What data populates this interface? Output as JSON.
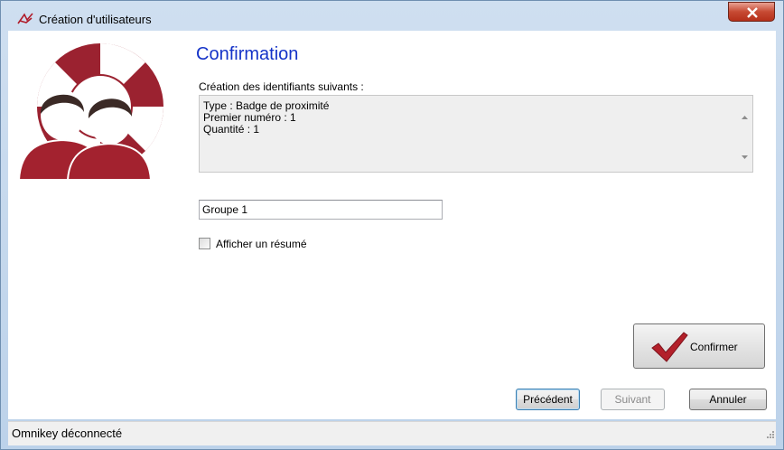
{
  "window": {
    "title": "Création d'utilisateurs",
    "app_icon": "users-wizard-icon",
    "close_icon": "close-icon"
  },
  "main": {
    "heading": "Confirmation",
    "summary_label": "Création des identifiants suivants :",
    "summary_lines": [
      "Type : Badge de proximité",
      "Premier numéro : 1",
      "Quantité : 1"
    ],
    "group_value": "Groupe 1",
    "show_summary_label": "Afficher un résumé",
    "show_summary_checked": false
  },
  "buttons": {
    "confirm": "Confirmer",
    "previous": "Précédent",
    "next": "Suivant",
    "cancel": "Annuler"
  },
  "status": {
    "text": "Omnikey déconnecté"
  },
  "colors": {
    "heading": "#1533c8",
    "logo_red": "#9b2230",
    "check_red": "#b3202a"
  }
}
